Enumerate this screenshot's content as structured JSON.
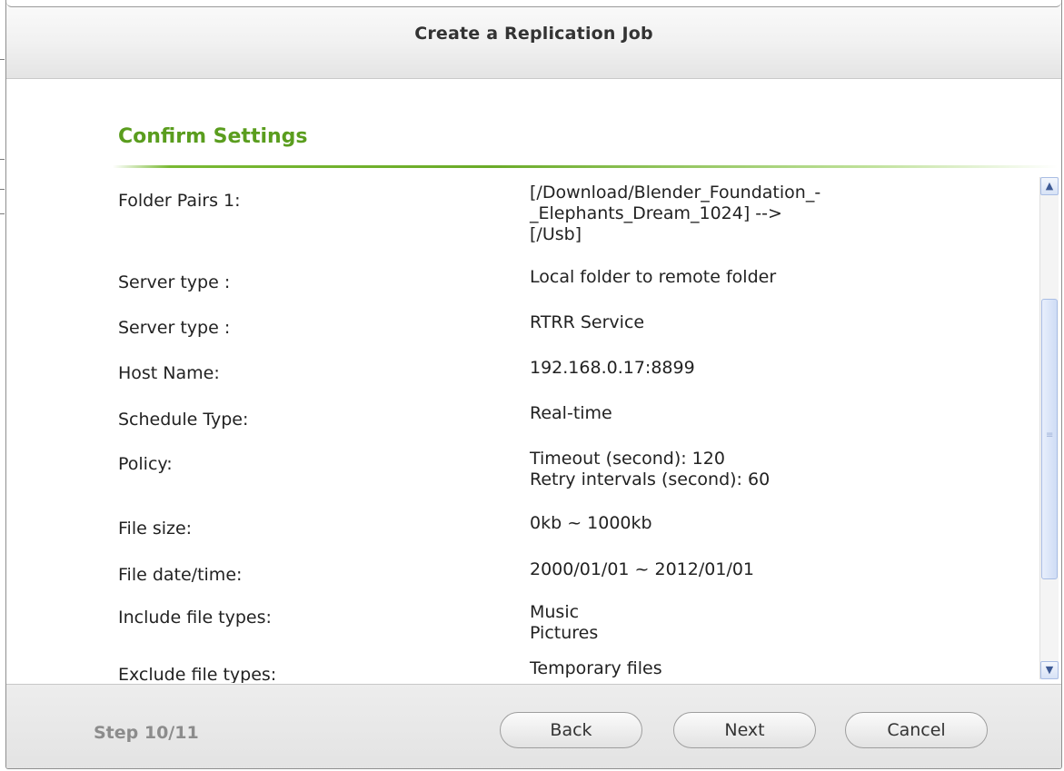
{
  "dialog": {
    "title": "Create a Replication Job"
  },
  "section": {
    "title": "Confirm Settings"
  },
  "settings": [
    {
      "label": "Folder Pairs 1:",
      "value": [
        "[/Download/Blender_Foundation_-",
        "_Elephants_Dream_1024] -->",
        "[/Usb]"
      ]
    },
    {
      "label": "Server type :",
      "value": [
        "Local folder to remote folder"
      ]
    },
    {
      "label": "Server type :",
      "value": [
        "RTRR Service"
      ]
    },
    {
      "label": "Host Name:",
      "value": [
        "192.168.0.17:8899"
      ]
    },
    {
      "label": "Schedule Type:",
      "value": [
        "Real-time"
      ]
    },
    {
      "label": "Policy:",
      "value": [
        "Timeout (second): 120",
        "Retry intervals (second): 60"
      ]
    },
    {
      "label": "File size:",
      "value": [
        "0kb ~ 1000kb"
      ]
    },
    {
      "label": "File date/time:",
      "value": [
        "2000/01/01 ~ 2012/01/01"
      ]
    },
    {
      "label": "Include file types:",
      "value": [
        "Music",
        "Pictures"
      ]
    },
    {
      "label": "Exclude file types:",
      "value": [
        "Temporary files"
      ]
    }
  ],
  "footer": {
    "step": "Step 10/11",
    "back_label": "Back",
    "next_label": "Next",
    "cancel_label": "Cancel"
  },
  "colors": {
    "section_title": "#5a9d1e",
    "scrollbar": "#cfdcf5"
  },
  "icons": {
    "scroll_up": "scroll-up-arrow-icon",
    "scroll_down": "scroll-down-arrow-icon"
  }
}
